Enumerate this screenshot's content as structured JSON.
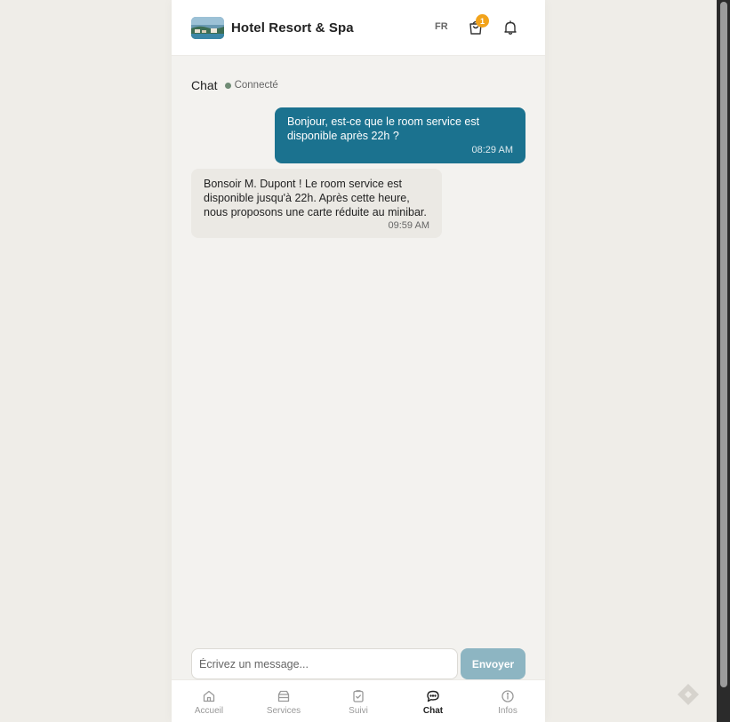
{
  "header": {
    "hotel_name": "Hotel Resort & Spa",
    "language": "FR",
    "cart_count": "1",
    "logo_icon": "hotel-photo-logo",
    "cart_icon": "shopping-bag-icon",
    "bell_icon": "bell-icon"
  },
  "chat": {
    "title": "Chat",
    "status": "Connecté",
    "status_color": "#6f8b74",
    "messages": [
      {
        "direction": "outgoing",
        "text": "Bonjour, est-ce que le room service est disponible après 22h ?",
        "time": "08:29 AM"
      },
      {
        "direction": "incoming",
        "text": "Bonsoir M. Dupont ! Le room service est disponible jusqu'à 22h. Après cette heure, nous proposons une carte réduite au minibar.",
        "time": "09:59 AM"
      }
    ]
  },
  "composer": {
    "placeholder": "Écrivez un message...",
    "value": "",
    "send_label": "Envoyer"
  },
  "nav": {
    "items": [
      {
        "label": "Accueil",
        "icon": "home-icon",
        "active": false
      },
      {
        "label": "Services",
        "icon": "services-icon",
        "active": false
      },
      {
        "label": "Suivi",
        "icon": "clipboard-icon",
        "active": false
      },
      {
        "label": "Chat",
        "icon": "chat-icon",
        "active": true
      },
      {
        "label": "Infos",
        "icon": "info-icon",
        "active": false
      }
    ]
  },
  "colors": {
    "accent": "#1b728f",
    "send_button": "#8db5c2",
    "badge": "#f2a31b",
    "background": "#efede8"
  }
}
